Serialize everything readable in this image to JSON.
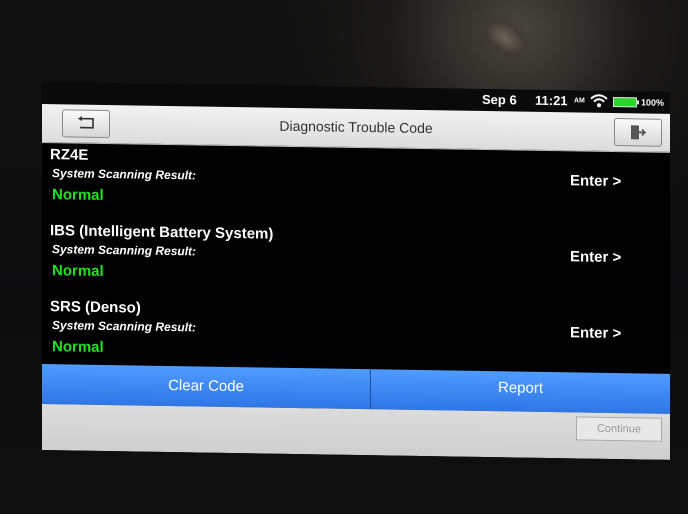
{
  "status": {
    "date": "Sep 6",
    "time": "11:21",
    "ampm": "AM",
    "battery_percent": "100%",
    "wifi_icon": "wifi-icon",
    "battery_icon": "battery-icon"
  },
  "header": {
    "title": "Diagnostic Trouble Code",
    "back_icon": "back-icon",
    "exit_icon": "exit-icon"
  },
  "systems": [
    {
      "name": "RZ4E",
      "scan_label": "System Scanning Result:",
      "result": "Normal",
      "enter": "Enter >"
    },
    {
      "name": "IBS (Intelligent Battery System)",
      "scan_label": "System Scanning Result:",
      "result": "Normal",
      "enter": "Enter >"
    },
    {
      "name": "SRS (Denso)",
      "scan_label": "System Scanning Result:",
      "result": "Normal",
      "enter": "Enter >"
    }
  ],
  "actions": {
    "clear_code": "Clear Code",
    "report": "Report"
  },
  "footer": {
    "continue": "Continue"
  },
  "colors": {
    "normal_status": "#22e022",
    "action_bar": "#3b86f0"
  }
}
